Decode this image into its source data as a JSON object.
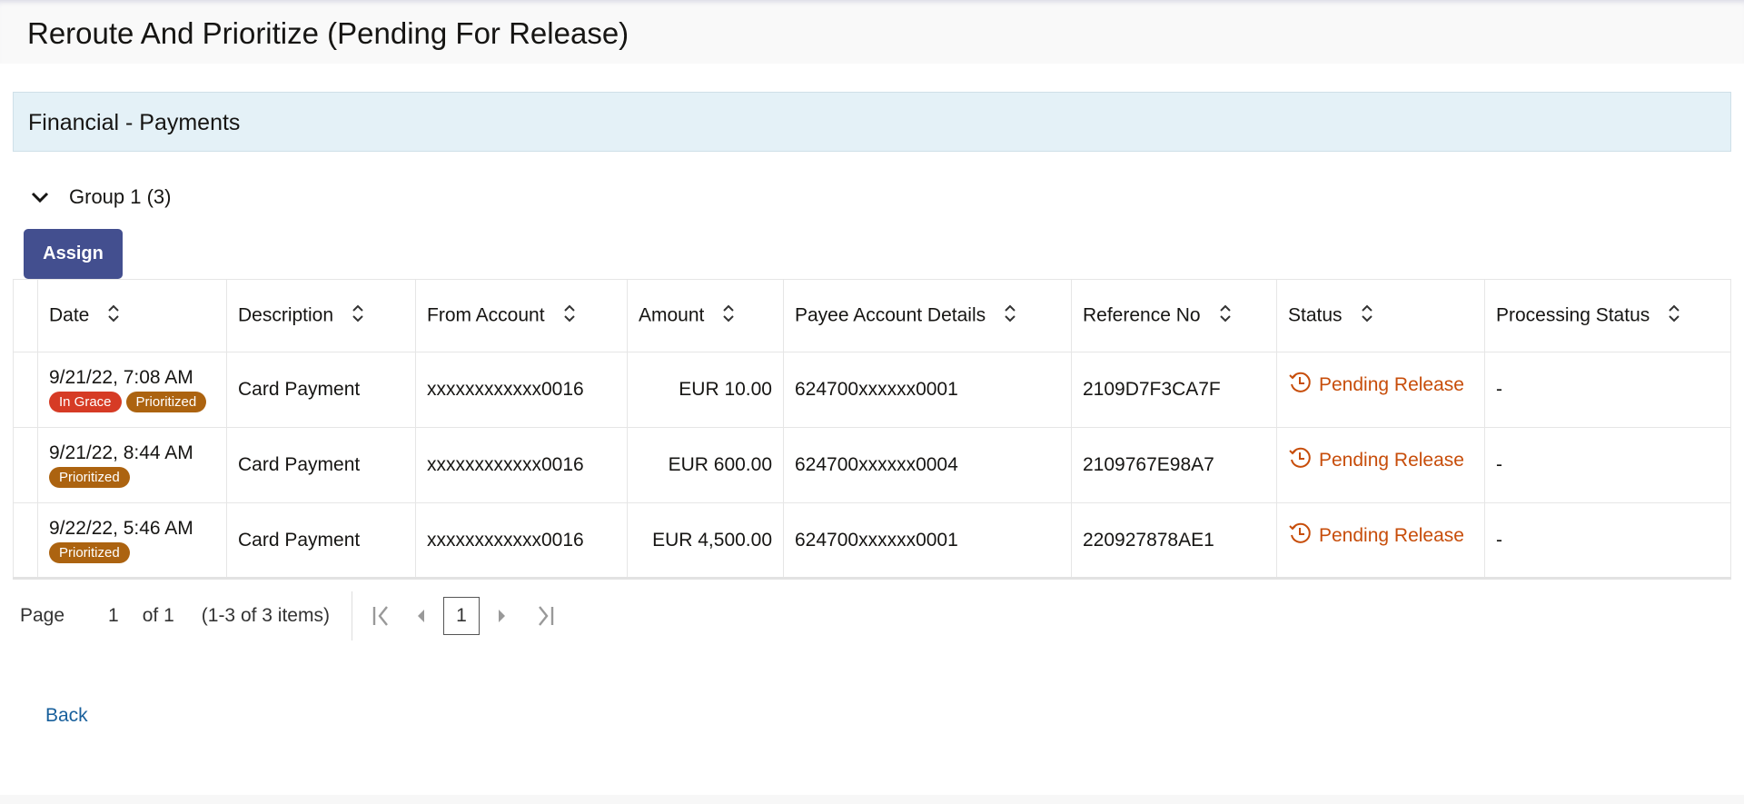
{
  "page": {
    "title": "Reroute And Prioritize (Pending For Release)"
  },
  "section": {
    "title": "Financial - Payments"
  },
  "group": {
    "label": "Group 1 (3)"
  },
  "toolbar": {
    "assign_label": "Assign"
  },
  "table": {
    "columns": [
      "Date",
      "Description",
      "From Account",
      "Amount",
      "Payee Account Details",
      "Reference No",
      "Status",
      "Processing Status"
    ],
    "rows": [
      {
        "date": "9/21/22, 7:08 AM",
        "badges": [
          "In Grace",
          "Prioritized"
        ],
        "description": "Card Payment",
        "from": "xxxxxxxxxxxx0016",
        "amount": "EUR 10.00",
        "payee": "624700xxxxxx0001",
        "ref": "2109D7F3CA7F",
        "status": "Pending Release",
        "processing": "-"
      },
      {
        "date": "9/21/22, 8:44 AM",
        "badges": [
          "Prioritized"
        ],
        "description": "Card Payment",
        "from": "xxxxxxxxxxxx0016",
        "amount": "EUR 600.00",
        "payee": "624700xxxxxx0004",
        "ref": "2109767E98A7",
        "status": "Pending Release",
        "processing": "-"
      },
      {
        "date": "9/22/22, 5:46 AM",
        "badges": [
          "Prioritized"
        ],
        "description": "Card Payment",
        "from": "xxxxxxxxxxxx0016",
        "amount": "EUR 4,500.00",
        "payee": "624700xxxxxx0001",
        "ref": "220927878AE1",
        "status": "Pending Release",
        "processing": "-"
      }
    ]
  },
  "pager": {
    "page_label": "Page",
    "page": "1",
    "of": "of 1",
    "items": "(1-3 of 3 items)",
    "current": "1"
  },
  "footer": {
    "back_label": "Back"
  },
  "colors": {
    "accent": "#434f8f",
    "pending": "#c74d0a",
    "grace": "#d63b25",
    "prioritized": "#ac6310",
    "link": "#19609c"
  }
}
